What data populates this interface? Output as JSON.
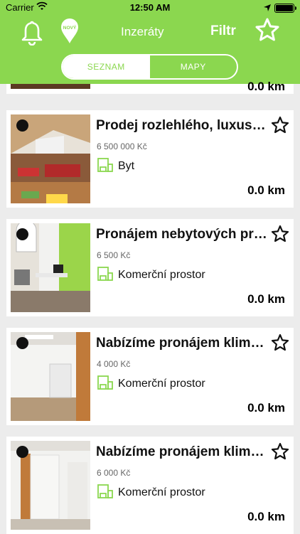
{
  "status": {
    "carrier": "Carrier",
    "time": "12:50 AM"
  },
  "nav": {
    "title": "Inzeráty",
    "filter": "Filtr",
    "novy_label": "NOVÝ"
  },
  "tabs": {
    "list": "SEZNAM",
    "map": "MAPY"
  },
  "colors": {
    "accent": "#8bd74f"
  },
  "partial_card": {
    "distance": "0.0 km"
  },
  "listings": [
    {
      "title": "Prodej rozlehlého, luxusního",
      "price": "6 500 000 Kč",
      "type": "Byt",
      "distance": "0.0 km"
    },
    {
      "title": "Pronájem nebytových prostor",
      "price": "6 500 Kč",
      "type": "Komerční prostor",
      "distance": "0.0 km"
    },
    {
      "title": "Nabízíme pronájem klimatizovaných",
      "price": "4 000 Kč",
      "type": "Komerční prostor",
      "distance": "0.0 km"
    },
    {
      "title": "Nabízíme pronájem klimatizovaných",
      "price": "6 000 Kč",
      "type": "Komerční prostor",
      "distance": "0.0 km"
    }
  ],
  "icons": {
    "bell": "bell-icon",
    "novy": "new-badge-icon",
    "favorite": "star-outline-icon",
    "property_type": "property-type-icon"
  }
}
